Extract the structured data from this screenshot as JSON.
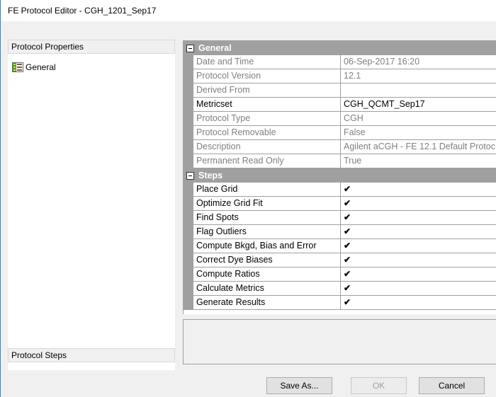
{
  "window": {
    "title": "FE Protocol Editor - CGH_1201_Sep17"
  },
  "left_panel": {
    "properties_header": "Protocol Properties",
    "tree_items": [
      {
        "label": "General",
        "icon": "property-grid-icon"
      }
    ],
    "steps_header": "Protocol Steps"
  },
  "grid": {
    "sections": [
      {
        "title": "General",
        "rows": [
          {
            "name": "Date and Time",
            "value": "06-Sep-2017 16:20",
            "enabled": false
          },
          {
            "name": "Protocol Version",
            "value": "12.1",
            "enabled": false
          },
          {
            "name": "Derived From",
            "value": "",
            "enabled": false
          },
          {
            "name": "Metricset",
            "value": "CGH_QCMT_Sep17",
            "enabled": true
          },
          {
            "name": "Protocol Type",
            "value": "CGH",
            "enabled": false
          },
          {
            "name": "Protocol Removable",
            "value": "False",
            "enabled": false
          },
          {
            "name": "Description",
            "value": "Agilent aCGH - FE 12.1 Default Protoc",
            "enabled": false
          },
          {
            "name": "Permanent Read Only",
            "value": "True",
            "enabled": false
          }
        ]
      },
      {
        "title": "Steps",
        "rows": [
          {
            "name": "Place Grid",
            "value": "✔",
            "enabled": true
          },
          {
            "name": "Optimize Grid Fit",
            "value": "✔",
            "enabled": true
          },
          {
            "name": "Find Spots",
            "value": "✔",
            "enabled": true
          },
          {
            "name": "Flag Outliers",
            "value": "✔",
            "enabled": true
          },
          {
            "name": "Compute Bkgd, Bias and Error",
            "value": "✔",
            "enabled": true
          },
          {
            "name": "Correct Dye Biases",
            "value": "✔",
            "enabled": true
          },
          {
            "name": "Compute Ratios",
            "value": "✔",
            "enabled": true
          },
          {
            "name": "Calculate Metrics",
            "value": "✔",
            "enabled": true
          },
          {
            "name": "Generate Results",
            "value": "✔",
            "enabled": true
          }
        ]
      }
    ]
  },
  "buttons": {
    "save_as": "Save As...",
    "ok": "OK",
    "cancel": "Cancel"
  },
  "colors": {
    "section_header": "#a0a0a0",
    "disabled_text": "#808080",
    "window_bg": "#f0f0f0"
  }
}
